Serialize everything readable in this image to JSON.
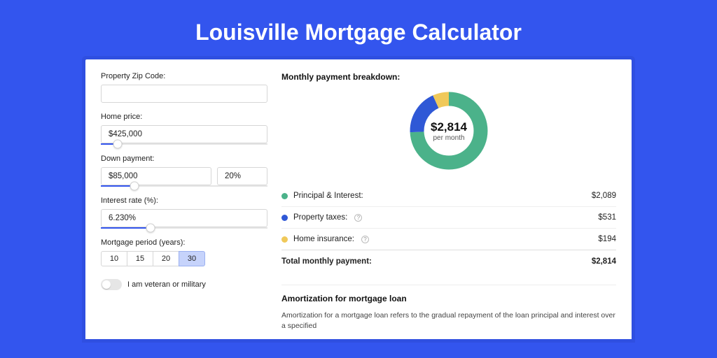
{
  "page": {
    "title": "Louisville Mortgage Calculator"
  },
  "form": {
    "zip": {
      "label": "Property Zip Code:",
      "value": ""
    },
    "price": {
      "label": "Home price:",
      "value": "$425,000",
      "slider_pct": 10
    },
    "down": {
      "label": "Down payment:",
      "value": "$85,000",
      "pct": "20%",
      "slider_pct": 20
    },
    "rate": {
      "label": "Interest rate (%):",
      "value": "6.230%",
      "slider_pct": 30
    },
    "period": {
      "label": "Mortgage period (years):",
      "options": [
        "10",
        "15",
        "20",
        "30"
      ],
      "selected": "30"
    },
    "veteran": {
      "label": "I am veteran or military",
      "on": false
    }
  },
  "breakdown": {
    "title": "Monthly payment breakdown:",
    "center_amount": "$2,814",
    "center_sub": "per month",
    "items": [
      {
        "label": "Principal & Interest:",
        "value": "$2,089",
        "color": "#4bb28a",
        "help": false
      },
      {
        "label": "Property taxes:",
        "value": "$531",
        "color": "#2f58d6",
        "help": true
      },
      {
        "label": "Home insurance:",
        "value": "$194",
        "color": "#f0c95a",
        "help": true
      }
    ],
    "total": {
      "label": "Total monthly payment:",
      "value": "$2,814"
    }
  },
  "amort": {
    "title": "Amortization for mortgage loan",
    "text": "Amortization for a mortgage loan refers to the gradual repayment of the loan principal and interest over a specified"
  },
  "chart_data": {
    "type": "pie",
    "title": "Monthly payment breakdown",
    "categories": [
      "Principal & Interest",
      "Property taxes",
      "Home insurance"
    ],
    "values": [
      2089,
      531,
      194
    ],
    "colors": [
      "#4bb28a",
      "#2f58d6",
      "#f0c95a"
    ],
    "total": 2814,
    "center_label": "$2,814 per month"
  }
}
